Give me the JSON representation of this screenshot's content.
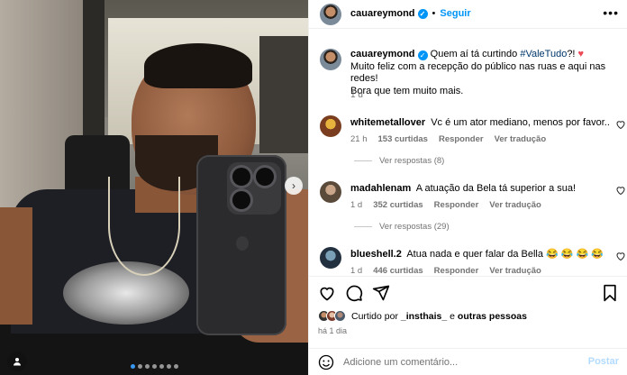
{
  "post": {
    "username": "cauareymond",
    "verified_icon": "verified-badge-icon",
    "bullet": "•",
    "follow_label": "Seguir",
    "more_icon": "•••",
    "accent_color": "#0095f6"
  },
  "photo": {
    "carousel_dots": 7,
    "active_dot": 1,
    "next_icon": "chevron-right-icon",
    "next_glyph": "›",
    "tag_icon": "user-tag-icon"
  },
  "caption": {
    "username": "cauareymond",
    "text_before": "Quem aí tá curtindo ",
    "hashtag": "#ValeTudo",
    "text_after_hashtag": "?! ",
    "heart": "♥",
    "line2": "Muito feliz com a recepção do público nas ruas e aqui nas redes!",
    "line3": "Bora que tem muito mais.",
    "time": "1 d"
  },
  "comments": [
    {
      "username": "whitemetallover",
      "text": "Vc é um ator mediano, menos por favor..",
      "time": "21 h",
      "likes": "153 curtidas",
      "reply_label": "Responder",
      "translate_label": "Ver tradução",
      "replies": "Ver respostas (8)"
    },
    {
      "username": "madahlenam",
      "text": "A atuação da Bela tá superior a sua!",
      "time": "1 d",
      "likes": "352 curtidas",
      "reply_label": "Responder",
      "translate_label": "Ver tradução",
      "replies": "Ver respostas (29)"
    },
    {
      "username": "blueshell.2",
      "text": "Atua nada e quer falar da Bella 😂 😂 😂 😂",
      "time": "1 d",
      "likes": "446 curtidas",
      "reply_label": "Responder",
      "translate_label": "Ver tradução",
      "replies": ""
    }
  ],
  "actions": {
    "like_icon": "heart-icon",
    "comment_icon": "comment-icon",
    "share_icon": "share-icon",
    "save_icon": "bookmark-icon"
  },
  "likes": {
    "prefix": "Curtido por ",
    "user": "_insthais_",
    "middle": " e ",
    "others": "outras pessoas"
  },
  "time_ago": "há 1 dia",
  "add_comment": {
    "placeholder": "Adicione um comentário...",
    "post_label": "Postar",
    "emoji_icon": "smiley-icon"
  }
}
